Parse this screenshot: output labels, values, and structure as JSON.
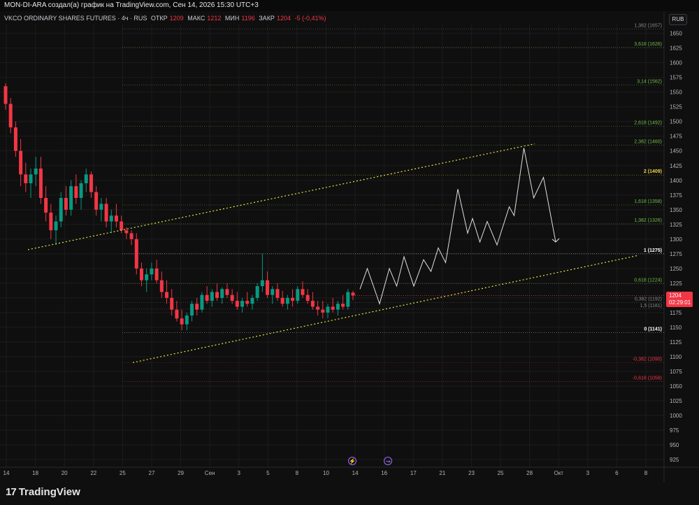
{
  "header": {
    "text": "MON-DI-ARA создал(а) график на TradingView.com, Сен 14, 2026 15:30 UTC+3"
  },
  "legend": {
    "symbol": "VKCO ORDINARY SHARES FUTURES · 4ч · RUS",
    "open_label": "ОТКР",
    "open": "1209",
    "high_label": "МАКС",
    "high": "1212",
    "low_label": "МИН",
    "low": "1196",
    "close_label": "ЗАКР",
    "close": "1204",
    "change": "-5 (-0,41%)"
  },
  "currency": "RUB",
  "current_price": {
    "value": "1204",
    "timer": "02:29:01"
  },
  "brand": {
    "name": "TradingView",
    "mark": "17"
  },
  "events": [
    {
      "glyph": "⚡"
    },
    {
      "glyph": "↝"
    }
  ],
  "colors": {
    "up": "#089981",
    "down": "#f23645",
    "grid": "#1c1c1c",
    "trend": "#e8e64a",
    "projection": "#e0e0e0"
  },
  "chart_data": {
    "type": "candlestick",
    "ylim": [
      912,
      1665
    ],
    "y_ticks": [
      925,
      950,
      975,
      1000,
      1025,
      1050,
      1075,
      1100,
      1125,
      1150,
      1175,
      1200,
      1225,
      1250,
      1275,
      1300,
      1325,
      1350,
      1375,
      1400,
      1425,
      1450,
      1475,
      1500,
      1525,
      1550,
      1575,
      1600,
      1625,
      1650
    ],
    "x_ticks": [
      "14",
      "18",
      "20",
      "22",
      "25",
      "27",
      "29",
      "Сен",
      "3",
      "5",
      "8",
      "10",
      "14",
      "16",
      "17",
      "21",
      "23",
      "25",
      "28",
      "Окт",
      "3",
      "6",
      "8"
    ],
    "fib_levels": [
      {
        "label": "1,382 (1657)",
        "value": 1657,
        "color": "#8a8a8a"
      },
      {
        "label": "3,618 (1626)",
        "value": 1626,
        "color": "#6fbf4a"
      },
      {
        "label": "3,14 (1562)",
        "value": 1562,
        "color": "#6fbf4a"
      },
      {
        "label": "2,618 (1492)",
        "value": 1492,
        "color": "#6fbf4a"
      },
      {
        "label": "2,382 (1460)",
        "value": 1460,
        "color": "#6fbf4a"
      },
      {
        "label": "2 (1409)",
        "value": 1409,
        "color": "#f0d23c"
      },
      {
        "label": "1,618 (1358)",
        "value": 1358,
        "color": "#6fbf4a"
      },
      {
        "label": "1,382 (1326)",
        "value": 1326,
        "color": "#6fbf4a"
      },
      {
        "label": "1 (1275)",
        "value": 1275,
        "color": "#ffffff"
      },
      {
        "label": "0,618 (1224)",
        "value": 1224,
        "color": "#6fbf4a"
      },
      {
        "label": "0,382 (1192)",
        "value": 1192,
        "color": "#8a8a8a"
      },
      {
        "label": "1,5 (1181)",
        "value": 1181,
        "color": "#8a8a8a"
      },
      {
        "label": "0 (1141)",
        "value": 1141,
        "color": "#ffffff"
      },
      {
        "label": "-0,382 (1090)",
        "value": 1090,
        "color": "#f23645"
      },
      {
        "label": "-0,618 (1058)",
        "value": 1058,
        "color": "#f23645"
      }
    ],
    "candles_ohlc": [
      [
        1560,
        1565,
        1520,
        1530
      ],
      [
        1530,
        1540,
        1480,
        1490
      ],
      [
        1490,
        1500,
        1440,
        1450
      ],
      [
        1450,
        1470,
        1390,
        1410
      ],
      [
        1410,
        1430,
        1380,
        1395
      ],
      [
        1395,
        1420,
        1370,
        1410
      ],
      [
        1410,
        1440,
        1390,
        1420
      ],
      [
        1420,
        1440,
        1360,
        1370
      ],
      [
        1370,
        1390,
        1330,
        1345
      ],
      [
        1345,
        1360,
        1300,
        1315
      ],
      [
        1315,
        1340,
        1290,
        1330
      ],
      [
        1330,
        1380,
        1320,
        1370
      ],
      [
        1370,
        1390,
        1340,
        1350
      ],
      [
        1350,
        1400,
        1340,
        1390
      ],
      [
        1390,
        1410,
        1360,
        1370
      ],
      [
        1370,
        1400,
        1350,
        1395
      ],
      [
        1395,
        1420,
        1380,
        1410
      ],
      [
        1410,
        1415,
        1370,
        1380
      ],
      [
        1380,
        1390,
        1340,
        1350
      ],
      [
        1350,
        1370,
        1330,
        1360
      ],
      [
        1360,
        1370,
        1320,
        1330
      ],
      [
        1330,
        1350,
        1310,
        1340
      ],
      [
        1340,
        1360,
        1320,
        1330
      ],
      [
        1330,
        1340,
        1310,
        1315
      ],
      [
        1315,
        1320,
        1300,
        1310
      ],
      [
        1310,
        1315,
        1290,
        1300
      ],
      [
        1300,
        1310,
        1240,
        1250
      ],
      [
        1250,
        1260,
        1220,
        1230
      ],
      [
        1230,
        1250,
        1210,
        1240
      ],
      [
        1240,
        1260,
        1230,
        1250
      ],
      [
        1250,
        1265,
        1225,
        1230
      ],
      [
        1230,
        1245,
        1200,
        1210
      ],
      [
        1210,
        1230,
        1190,
        1200
      ],
      [
        1200,
        1215,
        1170,
        1180
      ],
      [
        1180,
        1195,
        1160,
        1165
      ],
      [
        1165,
        1180,
        1145,
        1155
      ],
      [
        1155,
        1175,
        1145,
        1170
      ],
      [
        1170,
        1195,
        1160,
        1190
      ],
      [
        1190,
        1200,
        1170,
        1180
      ],
      [
        1180,
        1210,
        1175,
        1205
      ],
      [
        1205,
        1220,
        1190,
        1195
      ],
      [
        1195,
        1215,
        1185,
        1210
      ],
      [
        1210,
        1225,
        1195,
        1200
      ],
      [
        1200,
        1218,
        1190,
        1215
      ],
      [
        1215,
        1225,
        1200,
        1205
      ],
      [
        1205,
        1215,
        1190,
        1195
      ],
      [
        1195,
        1210,
        1180,
        1185
      ],
      [
        1185,
        1200,
        1175,
        1195
      ],
      [
        1195,
        1210,
        1185,
        1190
      ],
      [
        1190,
        1205,
        1180,
        1200
      ],
      [
        1200,
        1225,
        1195,
        1220
      ],
      [
        1220,
        1275,
        1210,
        1230
      ],
      [
        1230,
        1245,
        1200,
        1205
      ],
      [
        1205,
        1220,
        1190,
        1215
      ],
      [
        1215,
        1225,
        1195,
        1200
      ],
      [
        1200,
        1212,
        1185,
        1190
      ],
      [
        1190,
        1205,
        1180,
        1200
      ],
      [
        1200,
        1215,
        1185,
        1195
      ],
      [
        1195,
        1220,
        1190,
        1215
      ],
      [
        1215,
        1228,
        1200,
        1205
      ],
      [
        1205,
        1215,
        1190,
        1195
      ],
      [
        1195,
        1210,
        1180,
        1185
      ],
      [
        1185,
        1195,
        1170,
        1180
      ],
      [
        1180,
        1195,
        1165,
        1175
      ],
      [
        1175,
        1190,
        1165,
        1185
      ],
      [
        1185,
        1200,
        1175,
        1180
      ],
      [
        1180,
        1195,
        1170,
        1190
      ],
      [
        1190,
        1205,
        1180,
        1185
      ],
      [
        1185,
        1215,
        1180,
        1210
      ],
      [
        1209,
        1212,
        1196,
        1204
      ]
    ],
    "projection_path": [
      [
        0,
        1215
      ],
      [
        3,
        1250
      ],
      [
        8,
        1190
      ],
      [
        12,
        1250
      ],
      [
        15,
        1220
      ],
      [
        18,
        1270
      ],
      [
        22,
        1220
      ],
      [
        26,
        1265
      ],
      [
        29,
        1245
      ],
      [
        32,
        1285
      ],
      [
        35,
        1260
      ],
      [
        40,
        1385
      ],
      [
        44,
        1310
      ],
      [
        46,
        1335
      ],
      [
        49,
        1295
      ],
      [
        52,
        1330
      ],
      [
        56,
        1290
      ],
      [
        61,
        1355
      ],
      [
        63,
        1340
      ],
      [
        67,
        1455
      ],
      [
        71,
        1370
      ],
      [
        75,
        1405
      ],
      [
        80,
        1295
      ]
    ],
    "trend_upper": [
      [
        0,
        1282
      ],
      [
        100,
        1462
      ]
    ],
    "trend_lower": [
      [
        0,
        1090
      ],
      [
        100,
        1272
      ]
    ]
  }
}
